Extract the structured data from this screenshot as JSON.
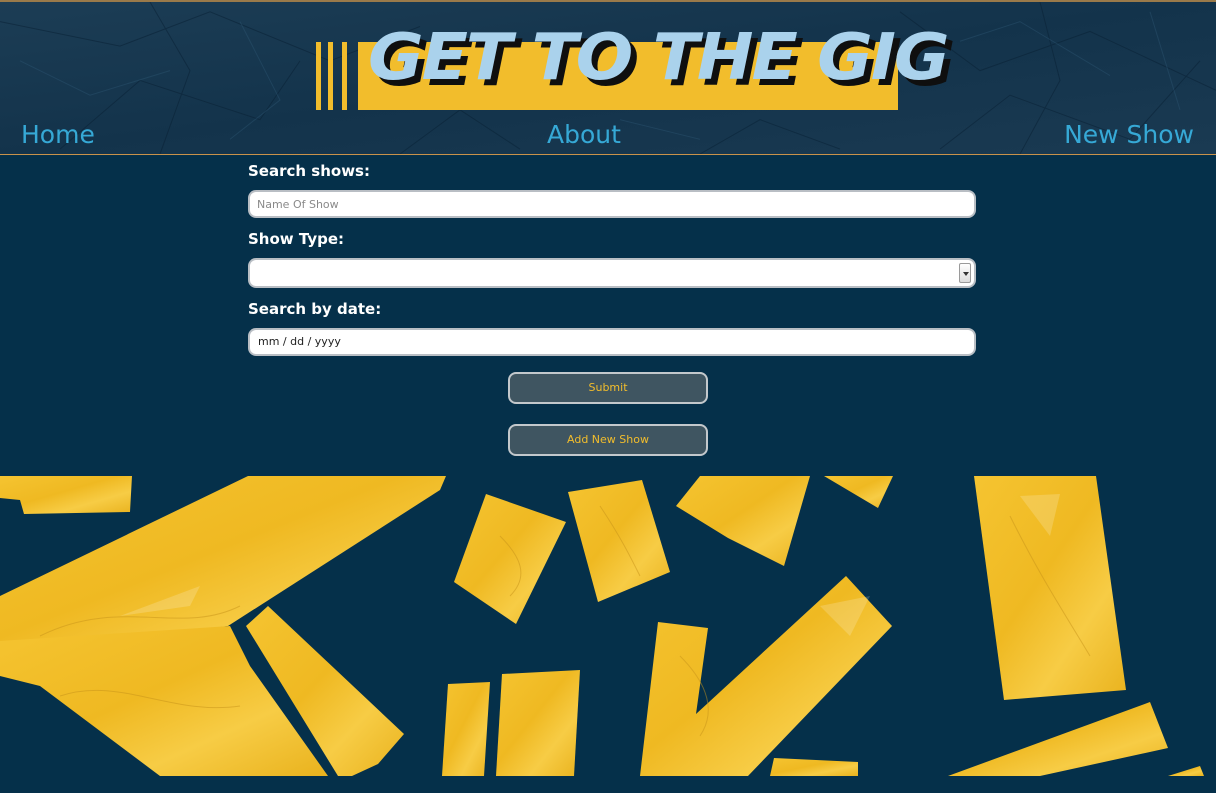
{
  "header": {
    "logo_text": "GET TO THE GIG",
    "nav": {
      "home": "Home",
      "about": "About",
      "new_show": "New Show"
    }
  },
  "search_form": {
    "search_label": "Search shows:",
    "search_placeholder": "Name Of Show",
    "search_value": "",
    "type_label": "Show Type:",
    "type_selected": "",
    "date_label": "Search by date:",
    "date_placeholder": "mm / dd / yyyy",
    "submit_label": "Submit",
    "add_label": "Add New Show"
  },
  "colors": {
    "background": "#05304a",
    "accent_yellow": "#f2bd2c",
    "nav_blue": "#36a9d6",
    "logo_blue": "#aad2ec",
    "button_bg": "#3f5561"
  },
  "icons": {
    "select_arrow": "chevron-down-icon"
  }
}
